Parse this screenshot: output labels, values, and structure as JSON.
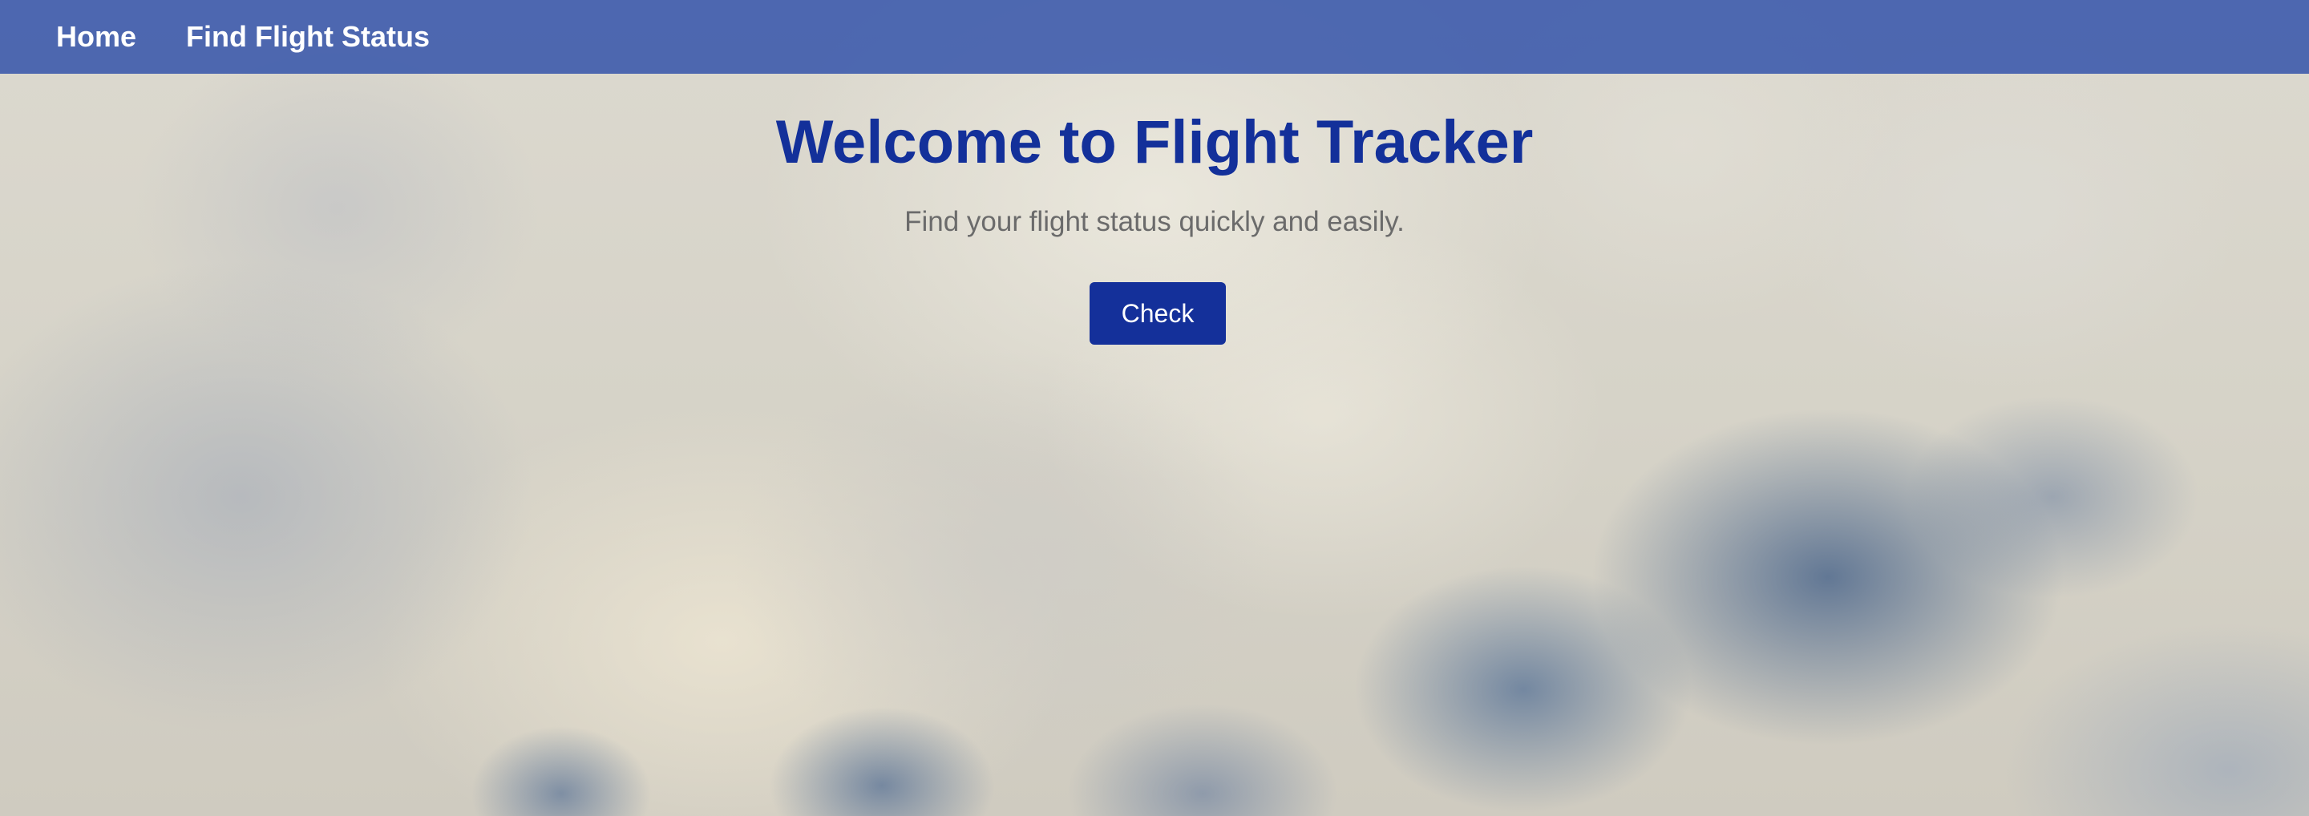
{
  "nav": {
    "items": [
      {
        "label": "Home"
      },
      {
        "label": "Find Flight Status"
      }
    ]
  },
  "hero": {
    "title": "Welcome to Flight Tracker",
    "subtitle": "Find your flight status quickly and easily.",
    "button_label": "Check"
  },
  "colors": {
    "navbar": "#2d4ea8",
    "title": "#13309a",
    "button": "#14309a",
    "subtitle": "#6b6b6b"
  },
  "background": "cloudy-sky-image"
}
